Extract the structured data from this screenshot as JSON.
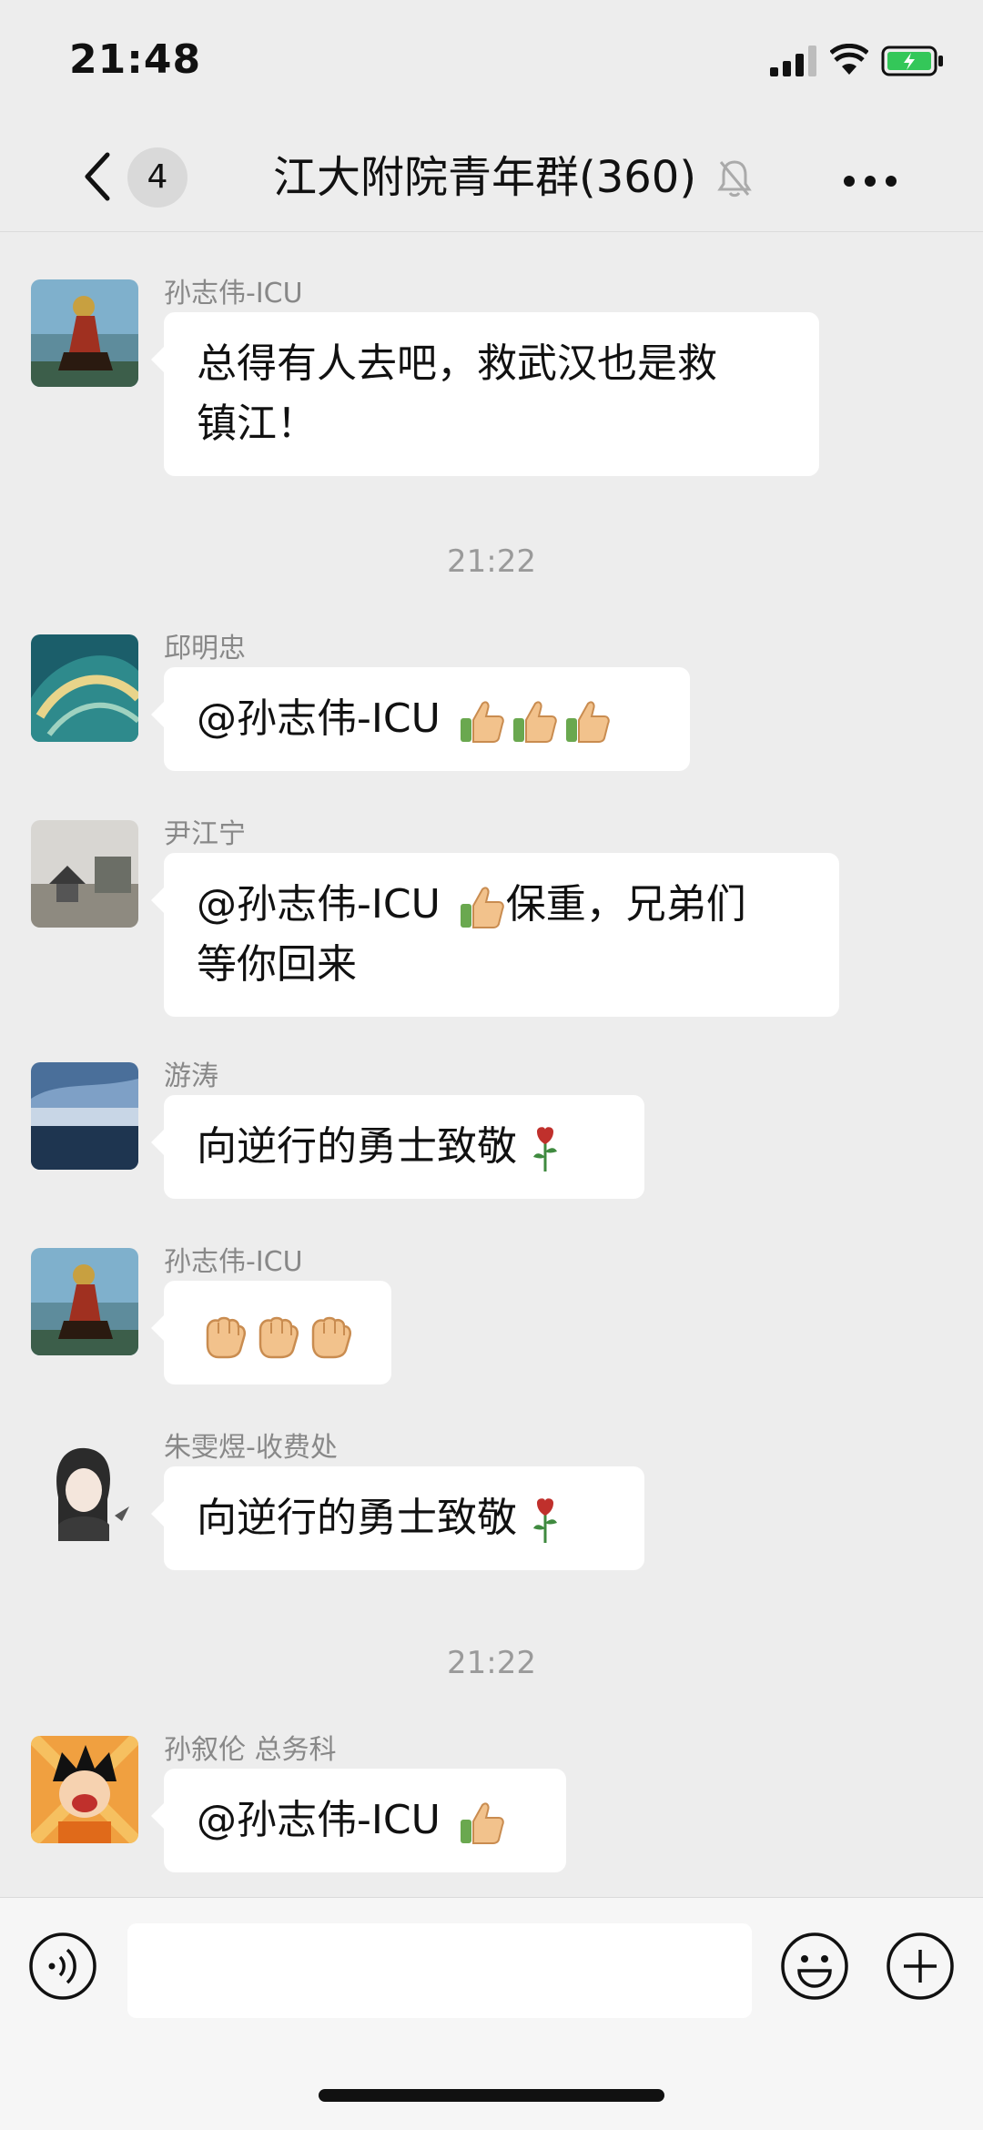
{
  "status": {
    "time": "21:48"
  },
  "nav": {
    "unread": "4",
    "title": "江大附院青年群(360)"
  },
  "messages": [
    {
      "sender": "孙志伟-ICU",
      "text": "总得有人去吧，救武汉也是救\n镇江！",
      "emoji": []
    },
    {
      "timestamp": "21:22"
    },
    {
      "sender": "邱明忠",
      "text": "@孙志伟-ICU ",
      "emoji": [
        "thumbs-up",
        "thumbs-up",
        "thumbs-up"
      ]
    },
    {
      "sender": "尹江宁",
      "text_a": "@孙志伟-ICU ",
      "text_b": "保重，兄弟们",
      "text_c": "等你回来",
      "emoji": [
        "thumbs-up"
      ]
    },
    {
      "sender": "游涛",
      "text": "向逆行的勇士致敬",
      "emoji": [
        "rose"
      ]
    },
    {
      "sender": "孙志伟-ICU",
      "text": "",
      "emoji": [
        "fist",
        "fist",
        "fist"
      ]
    },
    {
      "sender": "朱雯煜-收费处",
      "text": "向逆行的勇士致敬",
      "emoji": [
        "rose"
      ]
    },
    {
      "timestamp": "21:22"
    },
    {
      "sender": "孙叙伦 总务科",
      "text": "@孙志伟-ICU ",
      "emoji": [
        "thumbs-up"
      ]
    }
  ],
  "icons": {
    "back": "chevron-left-icon",
    "mute": "bell-off-icon",
    "more": "more-icon",
    "voice": "voice-icon",
    "emoji": "smile-icon",
    "plus": "plus-icon"
  }
}
